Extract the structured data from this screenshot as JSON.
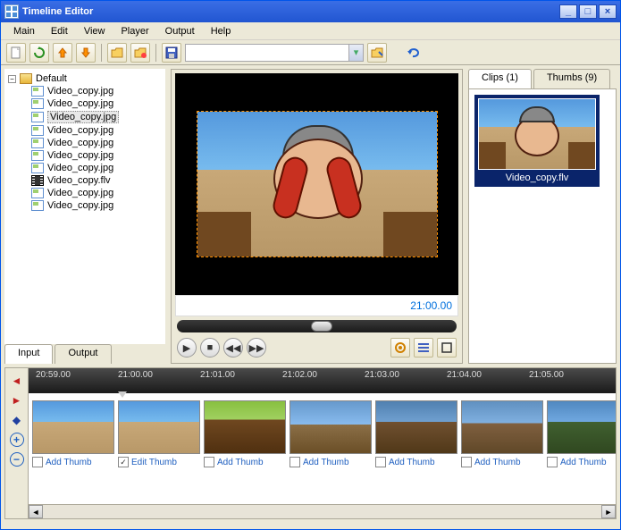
{
  "window": {
    "title": "Timeline Editor"
  },
  "menu": [
    "Main",
    "Edit",
    "View",
    "Player",
    "Output",
    "Help"
  ],
  "tree": {
    "root": "Default",
    "items": [
      {
        "name": "Video_copy.jpg",
        "type": "img"
      },
      {
        "name": "Video_copy.jpg",
        "type": "img"
      },
      {
        "name": "Video_copy.jpg",
        "type": "img",
        "selected": true
      },
      {
        "name": "Video_copy.jpg",
        "type": "img"
      },
      {
        "name": "Video_copy.jpg",
        "type": "img"
      },
      {
        "name": "Video_copy.jpg",
        "type": "img"
      },
      {
        "name": "Video_copy.jpg",
        "type": "img"
      },
      {
        "name": "Video_copy.flv",
        "type": "flv"
      },
      {
        "name": "Video_copy.jpg",
        "type": "img"
      },
      {
        "name": "Video_copy.jpg",
        "type": "img"
      }
    ]
  },
  "tabs": {
    "input": "Input",
    "output": "Output"
  },
  "player": {
    "time": "21:00.00"
  },
  "clips": {
    "tab1": "Clips (1)",
    "tab2": "Thumbs (9)",
    "item": "Video_copy.flv"
  },
  "ruler": [
    "20:59.00",
    "21:00.00",
    "21:01.00",
    "21:02.00",
    "21:03.00",
    "21:04.00",
    "21:05.00"
  ],
  "thumbs": [
    {
      "label": "Add Thumb",
      "checked": false
    },
    {
      "label": "Edit Thumb",
      "checked": true
    },
    {
      "label": "Add Thumb",
      "checked": false
    },
    {
      "label": "Add Thumb",
      "checked": false
    },
    {
      "label": "Add Thumb",
      "checked": false
    },
    {
      "label": "Add Thumb",
      "checked": false
    },
    {
      "label": "Add Thumb",
      "checked": false
    }
  ]
}
